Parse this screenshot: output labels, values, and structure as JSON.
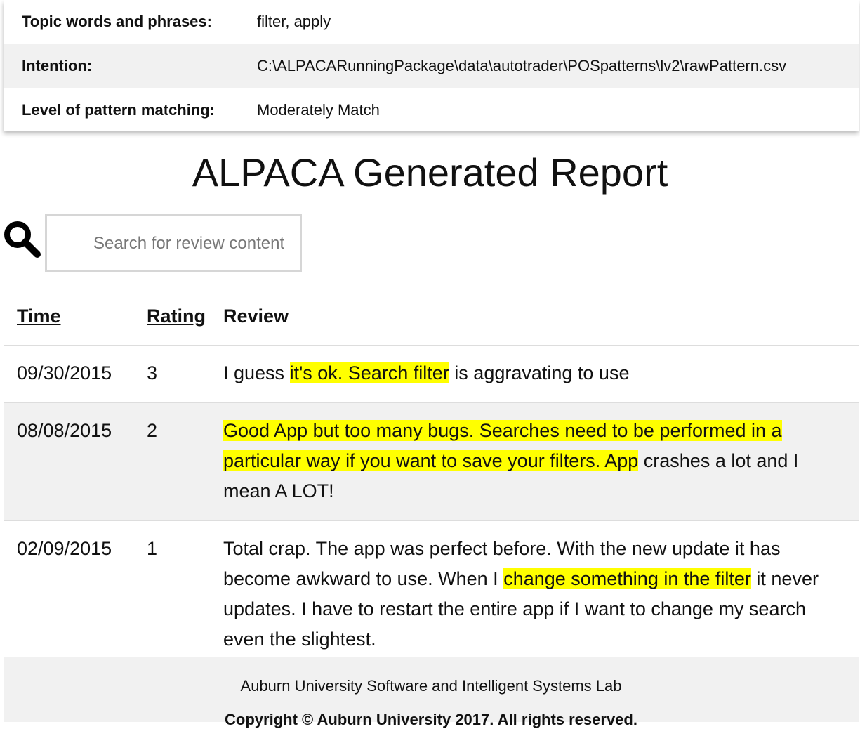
{
  "info": [
    {
      "label": "Topic words and phrases:",
      "value": "filter, apply"
    },
    {
      "label": "Intention:",
      "value": "C:\\ALPACARunningPackage\\data\\autotrader\\POSpatterns\\lv2\\rawPattern.csv"
    },
    {
      "label": "Level of pattern matching:",
      "value": "Moderately Match"
    }
  ],
  "title": "ALPACA Generated Report",
  "search": {
    "placeholder": "Search for review content",
    "icon": "magnifying-glass-icon"
  },
  "table": {
    "headers": {
      "time": "Time",
      "rating": "Rating",
      "review": "Review"
    },
    "rows": [
      {
        "time": "09/30/2015",
        "rating": "3",
        "review": [
          {
            "text": "I guess ",
            "hl": false
          },
          {
            "text": "it's ok. Search filter",
            "hl": true
          },
          {
            "text": " is aggravating to use",
            "hl": false
          }
        ]
      },
      {
        "time": "08/08/2015",
        "rating": "2",
        "review": [
          {
            "text": "Good App but too many bugs. Searches need to be performed in a particular way if you want to save your filters. App",
            "hl": true
          },
          {
            "text": " crashes a lot and I mean A LOT!",
            "hl": false
          }
        ]
      },
      {
        "time": "02/09/2015",
        "rating": "1",
        "review": [
          {
            "text": "Total crap. The app was perfect before. With the new update it has become awkward to use. When I ",
            "hl": false
          },
          {
            "text": "change something in the filter",
            "hl": true
          },
          {
            "text": " it never updates. I have to restart the entire app if I want to change my search even the slightest.",
            "hl": false
          }
        ]
      }
    ]
  },
  "footer": {
    "line1": "Auburn University Software and Intelligent Systems Lab",
    "line2": "Copyright © Auburn University 2017. All rights reserved."
  },
  "colors": {
    "highlight": "#ffff00",
    "shaded_row": "#f1f1f1",
    "search_border": "#d6d6d6"
  }
}
